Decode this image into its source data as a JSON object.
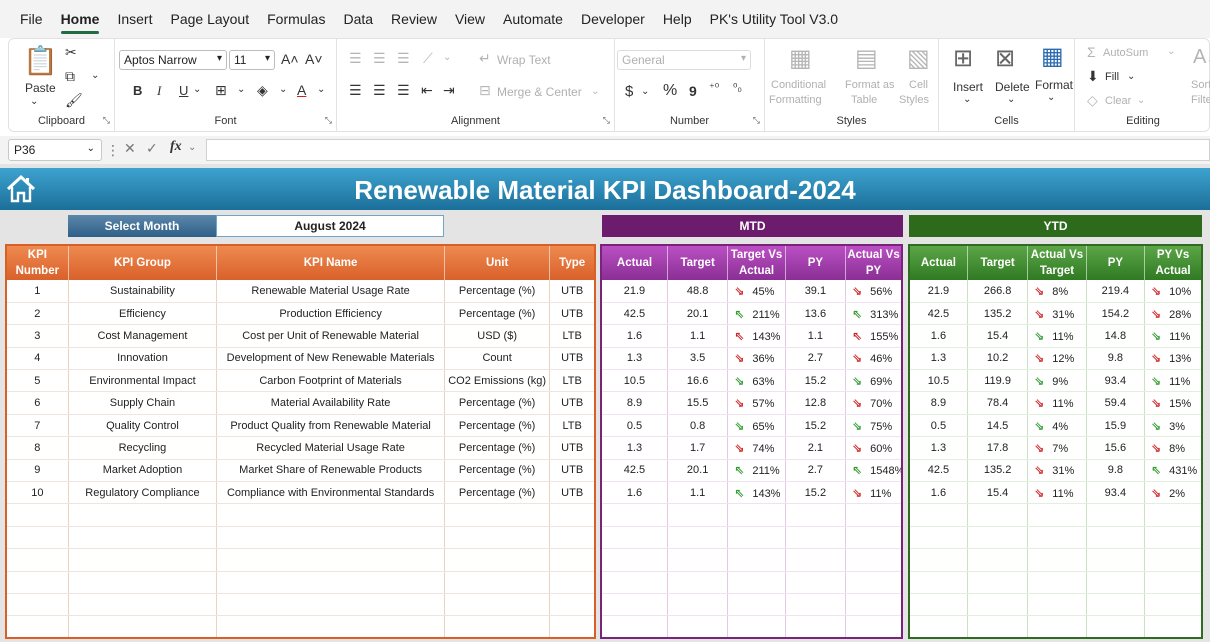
{
  "menu": {
    "tabs": [
      "File",
      "Home",
      "Insert",
      "Page Layout",
      "Formulas",
      "Data",
      "Review",
      "View",
      "Automate",
      "Developer",
      "Help",
      "PK's Utility Tool V3.0"
    ],
    "active": "Home"
  },
  "ribbon": {
    "clipboard": {
      "label": "Clipboard",
      "paste": "Paste"
    },
    "font": {
      "label": "Font",
      "font_name": "Aptos Narrow",
      "font_size": "11",
      "bold": "B",
      "italic": "I",
      "underline": "U"
    },
    "alignment": {
      "label": "Alignment",
      "wrap_text": "Wrap Text",
      "merge_center": "Merge & Center"
    },
    "number": {
      "label": "Number",
      "format": "General",
      "currency": "$",
      "percent": "%",
      "comma": "9"
    },
    "styles": {
      "label": "Styles",
      "conditional_1": "Conditional",
      "conditional_2": "Formatting",
      "format_table_1": "Format as",
      "format_table_2": "Table",
      "cell_styles_1": "Cell",
      "cell_styles_2": "Styles"
    },
    "cells": {
      "label": "Cells",
      "insert": "Insert",
      "delete": "Delete",
      "format": "Format"
    },
    "editing": {
      "label": "Editing",
      "autosum": "AutoSum",
      "fill": "Fill",
      "clear": "Clear",
      "sort_1": "Sort &",
      "sort_2": "Filter"
    }
  },
  "formula_bar": {
    "name_box": "P36",
    "fx": "fx",
    "formula": ""
  },
  "dashboard": {
    "title": "Renewable Material KPI Dashboard-2024",
    "select_month_label": "Select Month",
    "select_month_value": "August 2024",
    "mtd_label": "MTD",
    "ytd_label": "YTD"
  },
  "table": {
    "main_headers": [
      "KPI Number",
      "KPI Group",
      "KPI Name",
      "Unit",
      "Type"
    ],
    "mtd_headers": [
      "Actual",
      "Target",
      "Target Vs Actual",
      "PY",
      "Actual Vs PY"
    ],
    "ytd_headers": [
      "Actual",
      "Target",
      "Actual Vs Target",
      "PY",
      "PY Vs Actual"
    ],
    "empty_rows": 6,
    "rows": [
      {
        "num": "1",
        "group": "Sustainability",
        "name": "Renewable Material Usage Rate",
        "unit": "Percentage (%)",
        "type": "UTB",
        "mtd": {
          "actual": "21.9",
          "target": "48.8",
          "tva_dir": "down",
          "tva": "45%",
          "py": "39.1",
          "avp_dir": "down",
          "avp": "56%"
        },
        "ytd": {
          "actual": "21.9",
          "target": "266.8",
          "avt_dir": "down",
          "avt": "8%",
          "py": "219.4",
          "pva_dir": "down",
          "pva": "10%"
        }
      },
      {
        "num": "2",
        "group": "Efficiency",
        "name": "Production Efficiency",
        "unit": "Percentage (%)",
        "type": "UTB",
        "mtd": {
          "actual": "42.5",
          "target": "20.1",
          "tva_dir": "up",
          "tva": "211%",
          "py": "13.6",
          "avp_dir": "up",
          "avp": "313%"
        },
        "ytd": {
          "actual": "42.5",
          "target": "135.2",
          "avt_dir": "down",
          "avt": "31%",
          "py": "154.2",
          "pva_dir": "down",
          "pva": "28%"
        }
      },
      {
        "num": "3",
        "group": "Cost Management",
        "name": "Cost per Unit of Renewable Material",
        "unit": "USD ($)",
        "type": "LTB",
        "mtd": {
          "actual": "1.6",
          "target": "1.1",
          "tva_dir": "up-red",
          "tva": "143%",
          "py": "1.1",
          "avp_dir": "up-red",
          "avp": "155%"
        },
        "ytd": {
          "actual": "1.6",
          "target": "15.4",
          "avt_dir": "down-green",
          "avt": "11%",
          "py": "14.8",
          "pva_dir": "down-green",
          "pva": "11%"
        }
      },
      {
        "num": "4",
        "group": "Innovation",
        "name": "Development of New Renewable Materials",
        "unit": "Count",
        "type": "UTB",
        "mtd": {
          "actual": "1.3",
          "target": "3.5",
          "tva_dir": "down",
          "tva": "36%",
          "py": "2.7",
          "avp_dir": "down",
          "avp": "46%"
        },
        "ytd": {
          "actual": "1.3",
          "target": "10.2",
          "avt_dir": "down",
          "avt": "12%",
          "py": "9.8",
          "pva_dir": "down",
          "pva": "13%"
        }
      },
      {
        "num": "5",
        "group": "Environmental Impact",
        "name": "Carbon Footprint of Materials",
        "unit": "CO2 Emissions (kg)",
        "type": "LTB",
        "mtd": {
          "actual": "10.5",
          "target": "16.6",
          "tva_dir": "down-green",
          "tva": "63%",
          "py": "15.2",
          "avp_dir": "down-green",
          "avp": "69%"
        },
        "ytd": {
          "actual": "10.5",
          "target": "119.9",
          "avt_dir": "down-green",
          "avt": "9%",
          "py": "93.4",
          "pva_dir": "down-green",
          "pva": "11%"
        }
      },
      {
        "num": "6",
        "group": "Supply Chain",
        "name": "Material Availability Rate",
        "unit": "Percentage (%)",
        "type": "UTB",
        "mtd": {
          "actual": "8.9",
          "target": "15.5",
          "tva_dir": "down",
          "tva": "57%",
          "py": "12.8",
          "avp_dir": "down",
          "avp": "70%"
        },
        "ytd": {
          "actual": "8.9",
          "target": "78.4",
          "avt_dir": "down",
          "avt": "11%",
          "py": "59.4",
          "pva_dir": "down",
          "pva": "15%"
        }
      },
      {
        "num": "7",
        "group": "Quality Control",
        "name": "Product Quality from Renewable Material",
        "unit": "Percentage (%)",
        "type": "LTB",
        "mtd": {
          "actual": "0.5",
          "target": "0.8",
          "tva_dir": "down-green",
          "tva": "65%",
          "py": "15.2",
          "avp_dir": "down-green",
          "avp": "75%"
        },
        "ytd": {
          "actual": "0.5",
          "target": "14.5",
          "avt_dir": "down-green",
          "avt": "4%",
          "py": "15.9",
          "pva_dir": "down-green",
          "pva": "3%"
        }
      },
      {
        "num": "8",
        "group": "Recycling",
        "name": "Recycled Material Usage Rate",
        "unit": "Percentage (%)",
        "type": "UTB",
        "mtd": {
          "actual": "1.3",
          "target": "1.7",
          "tva_dir": "down",
          "tva": "74%",
          "py": "2.1",
          "avp_dir": "down",
          "avp": "60%"
        },
        "ytd": {
          "actual": "1.3",
          "target": "17.8",
          "avt_dir": "down",
          "avt": "7%",
          "py": "15.6",
          "pva_dir": "down",
          "pva": "8%"
        }
      },
      {
        "num": "9",
        "group": "Market Adoption",
        "name": "Market Share of Renewable Products",
        "unit": "Percentage (%)",
        "type": "UTB",
        "mtd": {
          "actual": "42.5",
          "target": "20.1",
          "tva_dir": "up",
          "tva": "211%",
          "py": "2.7",
          "avp_dir": "up",
          "avp": "1548%"
        },
        "ytd": {
          "actual": "42.5",
          "target": "135.2",
          "avt_dir": "down",
          "avt": "31%",
          "py": "9.8",
          "pva_dir": "up",
          "pva": "431%"
        }
      },
      {
        "num": "10",
        "group": "Regulatory Compliance",
        "name": "Compliance with Environmental Standards",
        "unit": "Percentage (%)",
        "type": "UTB",
        "mtd": {
          "actual": "1.6",
          "target": "1.1",
          "tva_dir": "up",
          "tva": "143%",
          "py": "15.2",
          "avp_dir": "down",
          "avp": "11%"
        },
        "ytd": {
          "actual": "1.6",
          "target": "15.4",
          "avt_dir": "down",
          "avt": "11%",
          "py": "93.4",
          "pva_dir": "down",
          "pva": "2%"
        }
      }
    ]
  },
  "colors": {
    "title_bar": "#1b6f9a",
    "main_header": "#d9612a",
    "mtd_header": "#6d1c6d",
    "ytd_header": "#2d6a1c",
    "arrow_good": "#2e9a2e",
    "arrow_bad": "#d12020"
  }
}
